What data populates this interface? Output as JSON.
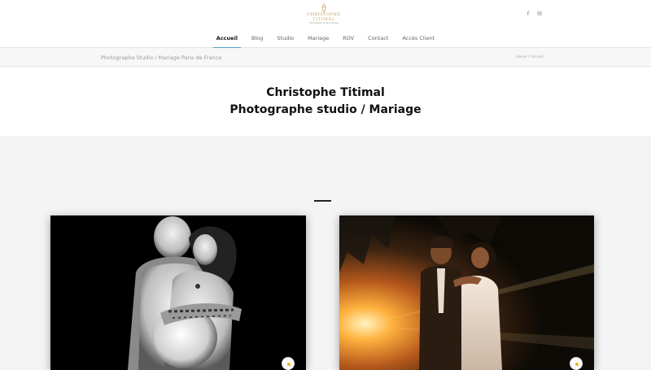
{
  "header": {
    "logo": {
      "line1": "CHRISTOPHE",
      "line2": "TITIMAL",
      "line3": "Photographe studio mariage"
    },
    "social": [
      {
        "icon": "facebook-icon",
        "glyph": "f"
      },
      {
        "icon": "mail-icon",
        "glyph": "✉"
      }
    ],
    "nav": [
      {
        "label": "Accueil",
        "active": true
      },
      {
        "label": "Blog",
        "active": false
      },
      {
        "label": "Studio",
        "active": false
      },
      {
        "label": "Mariage",
        "active": false
      },
      {
        "label": "RDV",
        "active": false
      },
      {
        "label": "Contact",
        "active": false
      },
      {
        "label": "Accès Client",
        "active": false
      }
    ]
  },
  "breadcrumb": {
    "left": "Photographe Studio / Mariage Paris de France",
    "right": "Home / Accueil"
  },
  "hero": {
    "title": "Christophe Titimal",
    "subtitle": "Photographe studio / Mariage"
  },
  "colors": {
    "accent": "#4fa3c7",
    "logo_gold": "#c9a76d",
    "page_bg": "#f4f4f4"
  },
  "cards": [
    {
      "subject": "maternity-photo",
      "badge": "daisy-icon"
    },
    {
      "subject": "wedding-couple-photo",
      "badge": "daisy-icon"
    }
  ]
}
